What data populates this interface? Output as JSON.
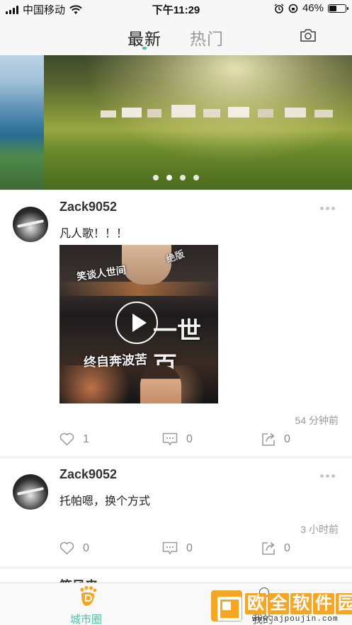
{
  "status_bar": {
    "carrier": "中国移动",
    "time": "下午11:29",
    "battery": "46%",
    "battery_level": 0.46
  },
  "header": {
    "tabs": [
      {
        "label": "最新",
        "active": true
      },
      {
        "label": "热门",
        "active": false
      }
    ],
    "camera_icon": "camera-icon"
  },
  "banner": {
    "slide_count": 4,
    "active_slide": 1
  },
  "posts": [
    {
      "username": "Zack9052",
      "content": "凡人歌！！！",
      "video_text": [
        "笑谈人世间",
        "绝版",
        "一世百",
        "终自奔波苦"
      ],
      "time": "54 分钟前",
      "likes": "1",
      "comments": "0",
      "shares": "0"
    },
    {
      "username": "Zack9052",
      "content": "托帕嗯，换个方式",
      "time": "3 小时前",
      "likes": "0",
      "comments": "0",
      "shares": "0"
    },
    {
      "username": "笔风来"
    }
  ],
  "tabbar": {
    "home_label": "城市圈",
    "me_label": "我的"
  },
  "watermark": {
    "title": [
      "欧",
      "全",
      "软",
      "件",
      "园"
    ],
    "url": "www.ajpoujin.com"
  },
  "colors": {
    "accent": "#4cc3a8",
    "watermark": "#f5a623"
  }
}
